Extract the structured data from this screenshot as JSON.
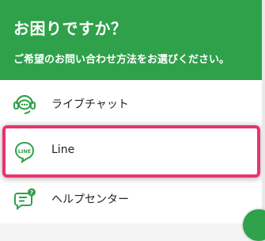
{
  "header": {
    "title": "お困りですか？",
    "subtitle": "ご希望のお問い合わせ方法をお選びください。"
  },
  "options": [
    {
      "label": "ライブチャット",
      "icon": "chat-headset-icon"
    },
    {
      "label": "Line",
      "icon": "line-icon"
    },
    {
      "label": "ヘルプセンター",
      "icon": "help-center-icon"
    }
  ],
  "colors": {
    "brand_green": "#2ea14a",
    "highlight_pink": "#e8336f",
    "header_text": "#ffffff",
    "item_text": "#222222"
  },
  "line_icon_text": "LINE"
}
